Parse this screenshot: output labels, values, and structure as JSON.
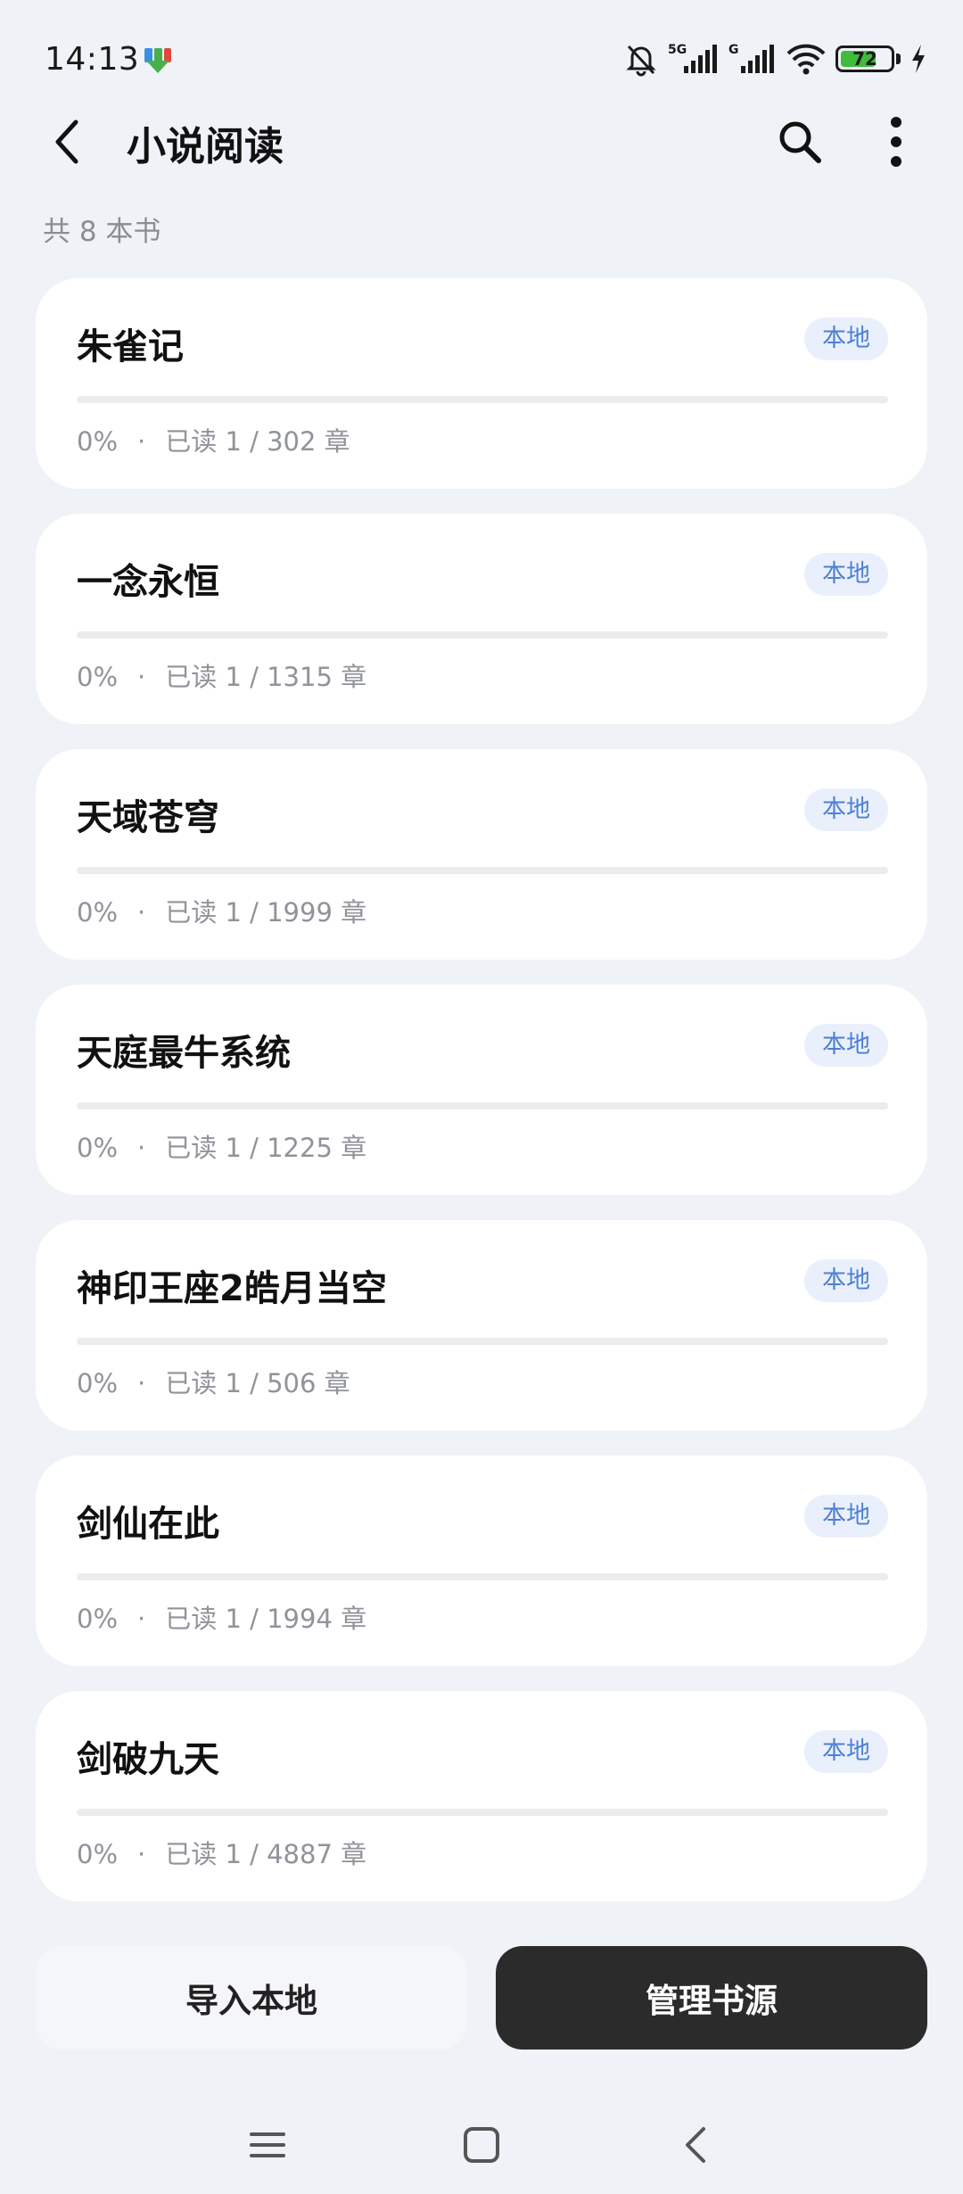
{
  "status_bar": {
    "time": "14:13",
    "battery": "72",
    "battery_level": 0.72,
    "network_labels": [
      "5G",
      "G"
    ],
    "icons": [
      "app-notification-icon",
      "mute-bell-icon",
      "signal-5g-icon",
      "signal-g-icon",
      "wifi-icon",
      "battery-icon",
      "charging-icon"
    ]
  },
  "header": {
    "title": "小说阅读",
    "back_icon": "chevron-left-icon",
    "search_icon": "search-icon",
    "more_icon": "more-vertical-icon"
  },
  "summary": {
    "count_label": "共 8 本书"
  },
  "books": [
    {
      "title": "朱雀记",
      "badge": "本地",
      "percent": "0%",
      "separator": "·",
      "progress_text": "已读 1 / 302 章",
      "progress": 0
    },
    {
      "title": "一念永恒",
      "badge": "本地",
      "percent": "0%",
      "separator": "·",
      "progress_text": "已读 1 / 1315 章",
      "progress": 0
    },
    {
      "title": "天域苍穹",
      "badge": "本地",
      "percent": "0%",
      "separator": "·",
      "progress_text": "已读 1 / 1999 章",
      "progress": 0
    },
    {
      "title": "天庭最牛系统",
      "badge": "本地",
      "percent": "0%",
      "separator": "·",
      "progress_text": "已读 1 / 1225 章",
      "progress": 0
    },
    {
      "title": "神印王座2皓月当空",
      "badge": "本地",
      "percent": "0%",
      "separator": "·",
      "progress_text": "已读 1 / 506 章",
      "progress": 0
    },
    {
      "title": "剑仙在此",
      "badge": "本地",
      "percent": "0%",
      "separator": "·",
      "progress_text": "已读 1 / 1994 章",
      "progress": 0
    },
    {
      "title": "剑破九天",
      "badge": "本地",
      "percent": "0%",
      "separator": "·",
      "progress_text": "已读 1 / 4887 章",
      "progress": 0
    }
  ],
  "actions": {
    "import_label": "导入本地",
    "manage_label": "管理书源"
  },
  "nav_bar": {
    "icons": [
      "menu-icon",
      "home-icon",
      "back-icon"
    ]
  },
  "colors": {
    "background": "#eff2f7",
    "accent": "#4d7fd6",
    "dark_button": "#2b2b2b",
    "battery_green": "#3ebc3a"
  }
}
